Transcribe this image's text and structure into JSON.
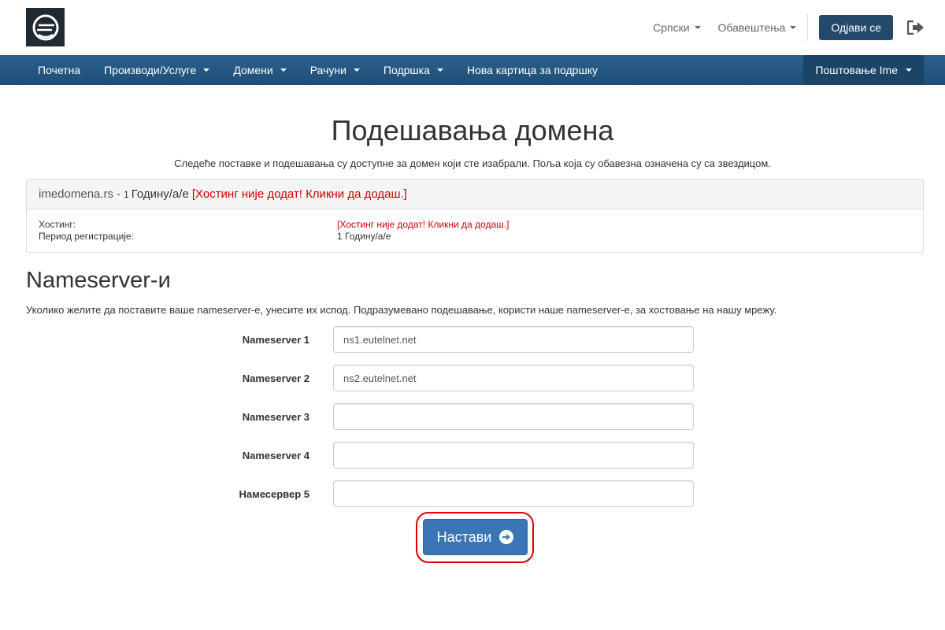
{
  "header": {
    "logo_icon": "company-logo-icon",
    "language_label": "Српски",
    "notifications_label": "Обавештења",
    "logout_label": "Одјави се",
    "exit_icon": "sign-out-icon"
  },
  "nav": {
    "items": [
      {
        "label": "Почетна",
        "dropdown": false
      },
      {
        "label": "Производи/Услуге",
        "dropdown": true
      },
      {
        "label": "Домени",
        "dropdown": true
      },
      {
        "label": "Рачуни",
        "dropdown": true
      },
      {
        "label": "Подршка",
        "dropdown": true
      },
      {
        "label": "Нова картица за подршку",
        "dropdown": false
      }
    ],
    "user_label": "Поштовање Ime"
  },
  "main": {
    "title": "Подешавања домена",
    "subtitle": "Следеће поставке и подешавања су доступне за домен који сте изабрали. Поља која су обавезна означена су са звездицом.",
    "domain": {
      "name": "imedomena.rs",
      "separator": "-",
      "years_number": "1",
      "period_text": "Годину/а/е",
      "hosting_link": "[Хостинг није додат! Кликни да додаш.]",
      "rows": [
        {
          "label": "Хостинг:",
          "value": "[Хостинг није додат! Кликни да додаш.]"
        },
        {
          "label": "Период регистрације:",
          "value": "1 Годину/а/е"
        }
      ]
    },
    "nameservers": {
      "title": "Nameserver-и",
      "description": "Уколико желите да поставите ваше nameserver-е, унесите их испод. Подразумевано подешавање, користи наше nameserver-е, за хостовање на нашу мрежу.",
      "fields": [
        {
          "label": "Nameserver 1",
          "value": "ns1.eutelnet.net"
        },
        {
          "label": "Nameserver 2",
          "value": "ns2.eutelnet.net"
        },
        {
          "label": "Nameserver 3",
          "value": ""
        },
        {
          "label": "Nameserver 4",
          "value": ""
        },
        {
          "label": "Намесервер 5",
          "value": ""
        }
      ]
    },
    "continue_label": "Настави",
    "continue_icon": "arrow-circle-right-icon"
  },
  "colors": {
    "nav_bg": "#255a87",
    "primary_button": "#3a76b6",
    "logout_button": "#25496b",
    "alert_red": "#cc0000",
    "highlight_ring": "#e00000"
  }
}
